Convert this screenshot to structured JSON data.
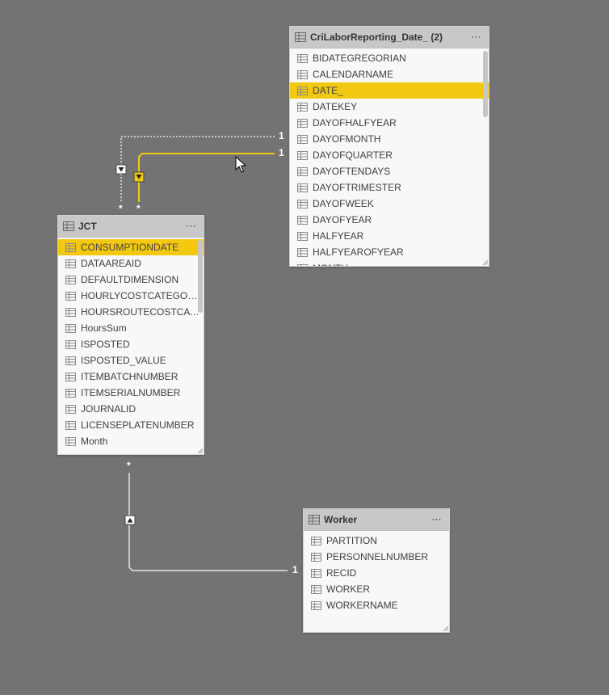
{
  "colors": {
    "canvas_bg": "#737373",
    "header_bg": "#c8c8c8",
    "card_bg": "#f8f8f8",
    "selected_bg": "#f2c811",
    "active_line": "#f2c811",
    "inactive_line": "#e6e6e6"
  },
  "tables": {
    "cri": {
      "title": "CriLaborReporting_Date_ (2)",
      "more_icon": "⋯",
      "fields": [
        "BIDATEGREGORIAN",
        "CALENDARNAME",
        "DATE_",
        "DATEKEY",
        "DAYOFHALFYEAR",
        "DAYOFMONTH",
        "DAYOFQUARTER",
        "DAYOFTENDAYS",
        "DAYOFTRIMESTER",
        "DAYOFWEEK",
        "DAYOFYEAR",
        "HALFYEAR",
        "HALFYEAROFYEAR",
        "MONTH"
      ],
      "selected": "DATE_"
    },
    "jct": {
      "title": "JCT",
      "more_icon": "⋯",
      "fields": [
        "CONSUMPTIONDATE",
        "DATAAREAID",
        "DEFAULTDIMENSION",
        "HOURLYCOSTCATEGORY...",
        "HOURSROUTECOSTCATE...",
        "HoursSum",
        "ISPOSTED",
        "ISPOSTED_VALUE",
        "ITEMBATCHNUMBER",
        "ITEMSERIALNUMBER",
        "JOURNALID",
        "LICENSEPLATENUMBER",
        "Month"
      ],
      "selected": "CONSUMPTIONDATE"
    },
    "worker": {
      "title": "Worker",
      "more_icon": "⋯",
      "fields": [
        "PARTITION",
        "PERSONNELNUMBER",
        "RECID",
        "WORKER",
        "WORKERNAME"
      ],
      "selected": ""
    }
  },
  "relationships": {
    "cri_jct_inactive": {
      "one_label": "1",
      "many_label": "*",
      "direction_icon": "arrow-down-icon"
    },
    "cri_jct_active": {
      "one_label": "1",
      "many_label": "*",
      "direction_icon": "arrow-down-icon"
    },
    "worker_jct": {
      "one_label": "1",
      "many_label": "*",
      "direction_icon": "arrow-up-icon"
    }
  }
}
